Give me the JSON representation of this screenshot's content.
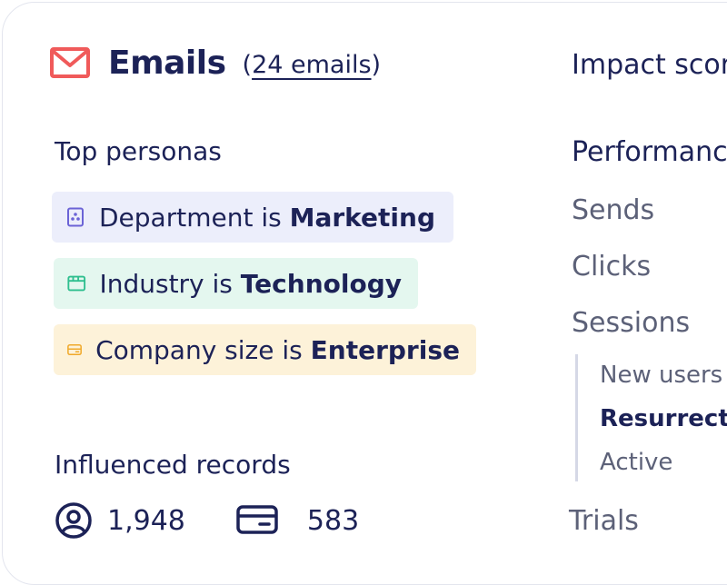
{
  "header": {
    "title": "Emails",
    "count_open": "(",
    "count_link": "24 emails",
    "count_close": ")"
  },
  "personas": {
    "heading": "Top personas",
    "items": [
      {
        "prefix": "Department is ",
        "value": "Marketing",
        "icon": "department-icon",
        "color": "#6b63d6"
      },
      {
        "prefix": "Industry is ",
        "value": "Technology",
        "icon": "industry-icon",
        "color": "#2fbf8f"
      },
      {
        "prefix": "Company size is ",
        "value": "Enterprise",
        "icon": "company-size-icon",
        "color": "#f0a92a"
      }
    ]
  },
  "influenced": {
    "heading": "Influenced records",
    "contacts": "1,948",
    "accounts": "583"
  },
  "right": {
    "impact": "Impact scor",
    "performance": "Performanc",
    "metrics": [
      "Sends",
      "Clicks",
      "Sessions"
    ],
    "session_breakdown": [
      "New users",
      "Resurrected",
      "Active"
    ],
    "trials": "Trials"
  },
  "colors": {
    "navy": "#1c2257",
    "grey": "#5c6178",
    "mail_red": "#f05a5a"
  }
}
